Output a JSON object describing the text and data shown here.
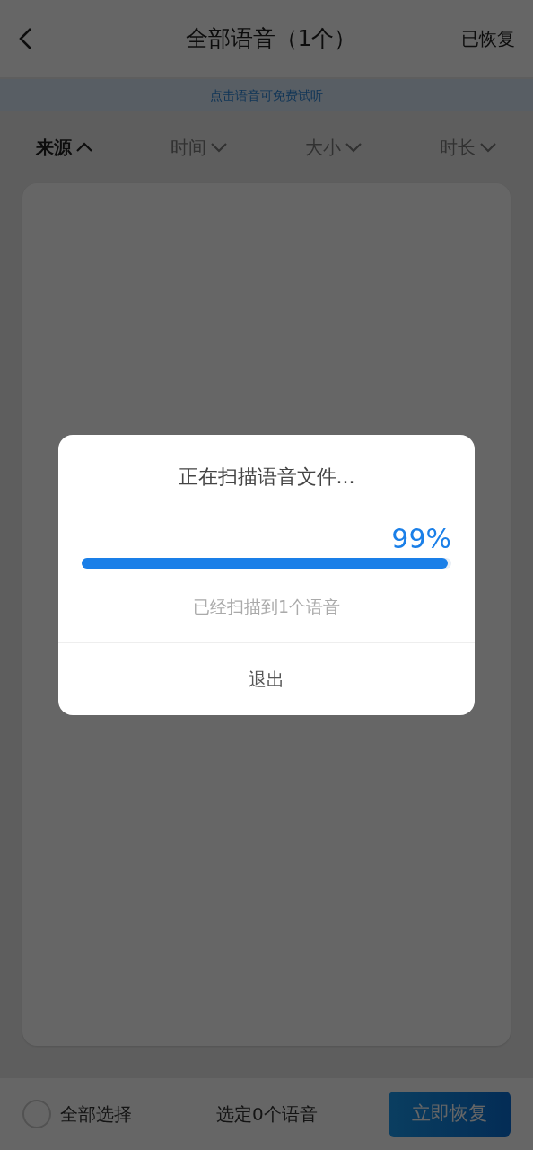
{
  "header": {
    "title": "全部语音（1个）",
    "action": "已恢复"
  },
  "banner": "点击语音可免费试听",
  "sort_options": [
    {
      "label": "来源",
      "selected": true
    },
    {
      "label": "时间",
      "selected": false
    },
    {
      "label": "大小",
      "selected": false
    },
    {
      "label": "时长",
      "selected": false
    }
  ],
  "footer": {
    "select_all": {
      "label": "全部选择",
      "checked": false
    },
    "selected_count": "选定0个语音",
    "button": "立即恢复"
  },
  "dialog": {
    "title": "正在扫描语音文件...",
    "percent": "99%",
    "level": 0.99,
    "status": "已经扫描到1个语音",
    "button": "退出"
  }
}
